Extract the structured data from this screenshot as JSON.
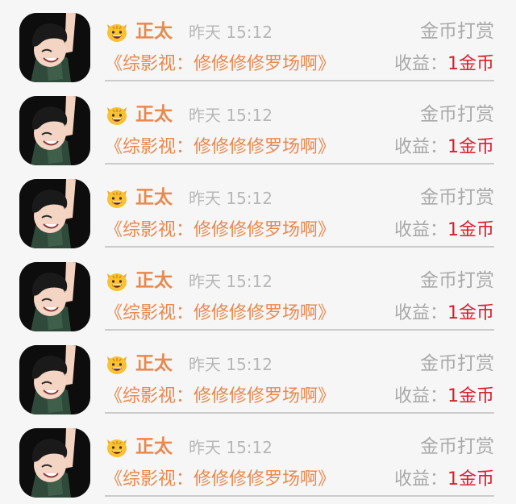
{
  "colors": {
    "accent_orange": "#e8894f",
    "muted_gray": "#a9a9a9",
    "coin_red": "#d71f2d",
    "background": "#f7f6f6"
  },
  "rows": [
    {
      "avatar": "cartoon-boy-avatar",
      "emoji": "cat-face-emoji",
      "name": "正太",
      "time": "昨天 15:12",
      "reward_type": "金币打赏",
      "work": "《综影视：修修修修罗场啊》",
      "earn_label": "收益：",
      "earn_value": "1金币"
    },
    {
      "avatar": "cartoon-boy-avatar",
      "emoji": "cat-face-emoji",
      "name": "正太",
      "time": "昨天 15:12",
      "reward_type": "金币打赏",
      "work": "《综影视：修修修修罗场啊》",
      "earn_label": "收益：",
      "earn_value": "1金币"
    },
    {
      "avatar": "cartoon-boy-avatar",
      "emoji": "cat-face-emoji",
      "name": "正太",
      "time": "昨天 15:12",
      "reward_type": "金币打赏",
      "work": "《综影视：修修修修罗场啊》",
      "earn_label": "收益：",
      "earn_value": "1金币"
    },
    {
      "avatar": "cartoon-boy-avatar",
      "emoji": "cat-face-emoji",
      "name": "正太",
      "time": "昨天 15:12",
      "reward_type": "金币打赏",
      "work": "《综影视：修修修修罗场啊》",
      "earn_label": "收益：",
      "earn_value": "1金币"
    },
    {
      "avatar": "cartoon-boy-avatar",
      "emoji": "cat-face-emoji",
      "name": "正太",
      "time": "昨天 15:12",
      "reward_type": "金币打赏",
      "work": "《综影视：修修修修罗场啊》",
      "earn_label": "收益：",
      "earn_value": "1金币"
    },
    {
      "avatar": "cartoon-boy-avatar",
      "emoji": "cat-face-emoji",
      "name": "正太",
      "time": "昨天 15:12",
      "reward_type": "金币打赏",
      "work": "《综影视：修修修修罗场啊》",
      "earn_label": "收益：",
      "earn_value": "1金币"
    }
  ]
}
